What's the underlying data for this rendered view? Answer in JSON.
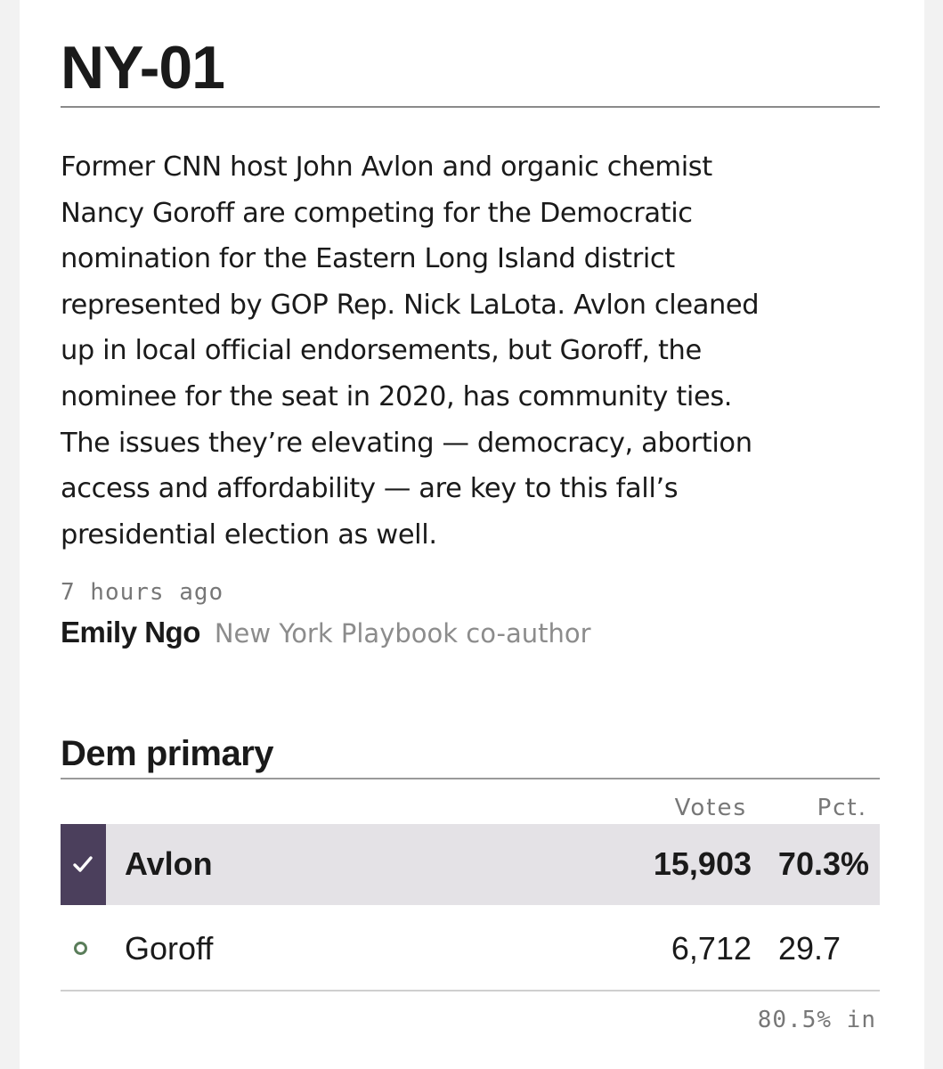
{
  "district": "NY-01",
  "summary_lines": [
    "Former CNN host John Avlon and organic chemist",
    "Nancy Goroff are competing for the Democratic",
    "nomination for the Eastern Long Island district",
    "represented by GOP Rep. Nick LaLota. Avlon cleaned",
    "up in local official endorsements, but Goroff, the",
    "nominee for the seat in 2020, has community ties.",
    "The issues they’re elevating — democracy, abortion",
    "access and affordability — are key to this fall’s",
    "presidential election as well."
  ],
  "timestamp": "7 hours ago",
  "author": {
    "name": "Emily Ngo",
    "role": "New York Playbook co-author"
  },
  "race": {
    "title": "Dem primary",
    "columns": {
      "votes": "Votes",
      "pct": "Pct."
    },
    "candidates": [
      {
        "name": "Avlon",
        "votes": "15,903",
        "pct": "70.3%",
        "winner": true,
        "icon": "check-icon"
      },
      {
        "name": "Goroff",
        "votes": "6,712",
        "pct": "29.7",
        "winner": false,
        "icon": "dot-icon"
      }
    ],
    "reporting": "80.5% in"
  },
  "colors": {
    "winner_marker": "#4b3f5c",
    "winner_row": "#e4e2e6",
    "candidate_dot": "#5a7d5a"
  }
}
